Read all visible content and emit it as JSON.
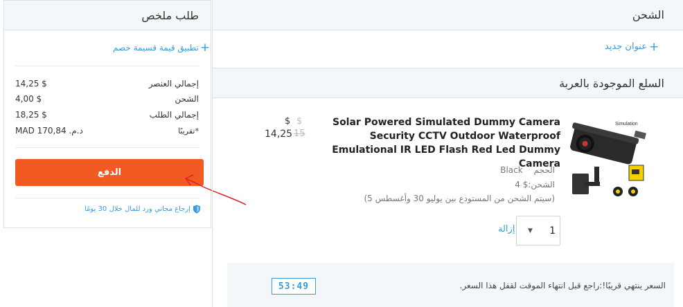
{
  "summary": {
    "title": "طلب ملخص",
    "discount_label": "تطبيق قيمة قسيمة خصم",
    "rows": [
      {
        "label": "إجمالي العنصر",
        "value": "14,25 $"
      },
      {
        "label": "الشحن",
        "value": "4,00 $"
      },
      {
        "label": "إجمالي الطلب",
        "value": "18,25 $"
      },
      {
        "label": "*تقريبًا",
        "value": "MAD 170,84 .د.م"
      }
    ],
    "checkout_label": "الدفع",
    "return_note": "إرجاع مجاني ورد للمال خلال 30 يومًا"
  },
  "shipping": {
    "title": "الشحن",
    "new_address_label": "عنوان جديد"
  },
  "cart": {
    "title": "السلع الموجودة بالعربة",
    "item": {
      "title": "Solar Powered Simulated Dummy Camera Security CCTV Outdoor Waterproof Emulational IR LED Flash Red Led Dummy Camera",
      "price_currency": "$",
      "old_price_currency": "$",
      "old_price": "15",
      "price": "14,25",
      "size_label": "الحجم",
      "size_value": "Black",
      "shipping_line": "الشحن:$ 4",
      "shipping_eta": "(سيتم الشحن من المستودع بين يوليو 30 وأغسطس 5)",
      "quantity": "1",
      "remove_label": "إزالة",
      "image_text": "Simulation"
    }
  },
  "timer": {
    "value": "53:49",
    "message": "السعر ينتهي قريبًا!:راجع قبل انتهاء الموقت لقفل هذا السعر."
  },
  "colors": {
    "accent": "#3a9ad9",
    "checkout": "#f15a22",
    "annotation": "#e02020"
  }
}
